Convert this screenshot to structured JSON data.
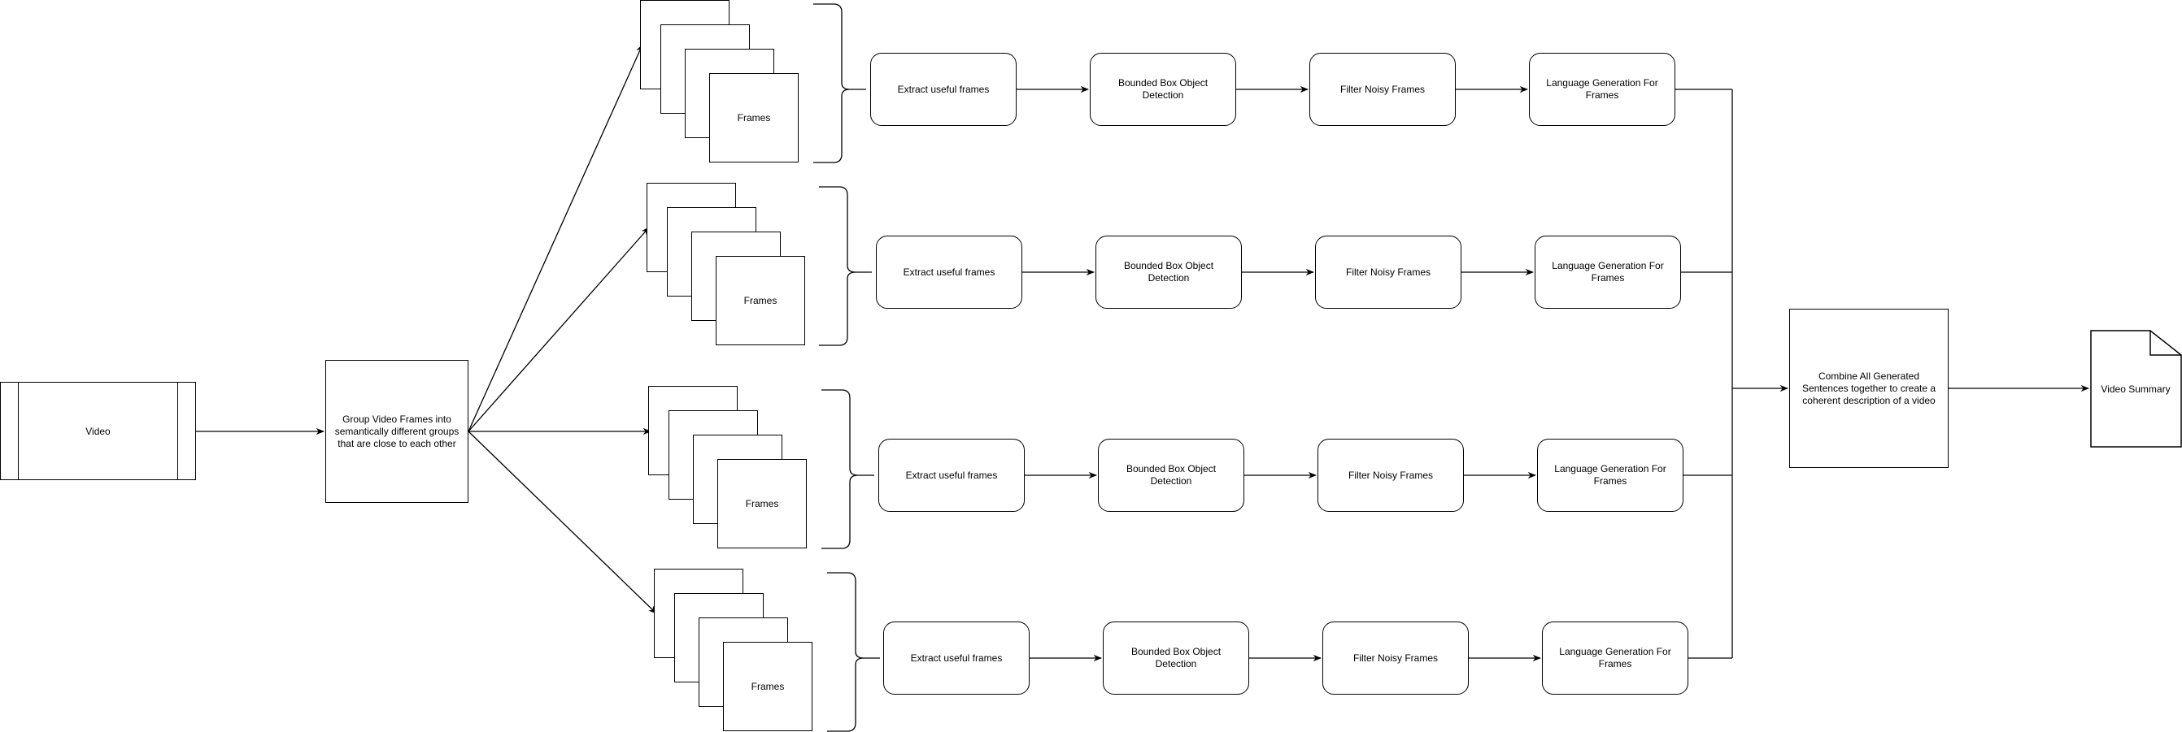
{
  "diagram": {
    "source": {
      "label": "Video"
    },
    "grouping": {
      "label": "Group Video Frames into semantically different groups that are close to each other"
    },
    "branches": [
      {
        "frames_label": "Frames",
        "steps": [
          "Extract useful frames",
          "Bounded Box Object Detection",
          "Filter Noisy Frames",
          "Language Generation For Frames"
        ]
      },
      {
        "frames_label": "Frames",
        "steps": [
          "Extract useful frames",
          "Bounded Box Object Detection",
          "Filter Noisy Frames",
          "Language Generation For Frames"
        ]
      },
      {
        "frames_label": "Frames",
        "steps": [
          "Extract useful frames",
          "Bounded Box Object Detection",
          "Filter Noisy Frames",
          "Language Generation For Frames"
        ]
      },
      {
        "frames_label": "Frames",
        "steps": [
          "Extract useful frames",
          "Bounded Box Object Detection",
          "Filter Noisy Frames",
          "Language Generation For Frames"
        ]
      }
    ],
    "combine": {
      "label": "Combine All Generated Sentences together to create a coherent description of a video"
    },
    "output": {
      "label": "Video Summary"
    }
  }
}
